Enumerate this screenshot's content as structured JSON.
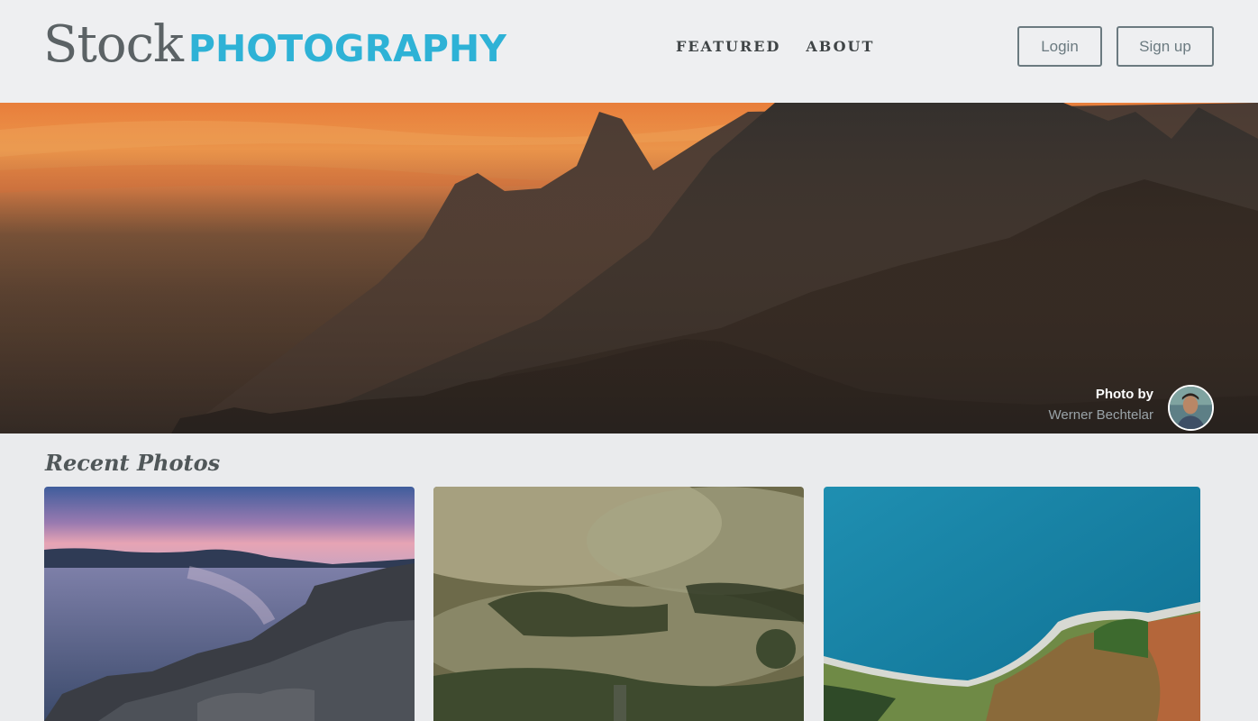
{
  "logo": {
    "stock": "Stock",
    "photography": "PHOTOGRAPHY"
  },
  "nav": {
    "featured": "FEATURED",
    "about": "ABOUT"
  },
  "auth": {
    "login": "Login",
    "signup": "Sign up"
  },
  "hero": {
    "credit_label": "Photo by",
    "credit_name": "Werner Bechtelar"
  },
  "recent": {
    "title": "Recent Photos"
  },
  "colors": {
    "accent": "#2eb2d6",
    "logo_gray": "#5b6265",
    "background": "#eaebed",
    "button_border": "#6b7a80"
  }
}
